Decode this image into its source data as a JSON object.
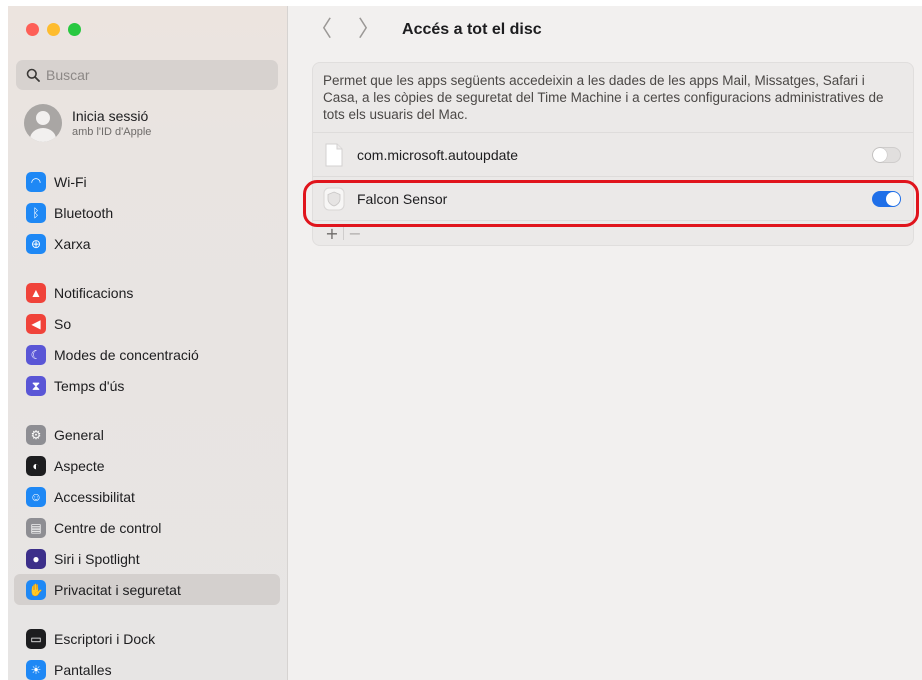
{
  "window": {
    "traffic_lights": {
      "close": "#fe5f57",
      "minimize": "#febc2e",
      "zoom": "#28c840"
    }
  },
  "sidebar": {
    "search": {
      "placeholder": "Buscar",
      "value": ""
    },
    "account": {
      "line1": "Inicia sessió",
      "line2": "amb l'ID d'Apple"
    },
    "groups": [
      [
        {
          "label": "Wi-Fi",
          "icon": "wifi-icon",
          "color": "#1e88f5",
          "glyph": "◠"
        },
        {
          "label": "Bluetooth",
          "icon": "bluetooth-icon",
          "color": "#1e88f5",
          "glyph": "ᛒ"
        },
        {
          "label": "Xarxa",
          "icon": "globe-icon",
          "color": "#1e88f5",
          "glyph": "⊕"
        }
      ],
      [
        {
          "label": "Notificacions",
          "icon": "bell-icon",
          "color": "#f0433a",
          "glyph": "▲"
        },
        {
          "label": "So",
          "icon": "speaker-icon",
          "color": "#f0433a",
          "glyph": "◀"
        },
        {
          "label": "Modes de concentració",
          "icon": "moon-icon",
          "color": "#5a56d6",
          "glyph": "☾"
        },
        {
          "label": "Temps d'ús",
          "icon": "hourglass-icon",
          "color": "#5a56d6",
          "glyph": "⧗"
        }
      ],
      [
        {
          "label": "General",
          "icon": "gear-icon",
          "color": "#8e8e93",
          "glyph": "⚙"
        },
        {
          "label": "Aspecte",
          "icon": "appearance-icon",
          "color": "#1d1d1f",
          "glyph": "◐"
        },
        {
          "label": "Accessibilitat",
          "icon": "accessibility-icon",
          "color": "#1e88f5",
          "glyph": "☺"
        },
        {
          "label": "Centre de control",
          "icon": "control-center-icon",
          "color": "#8e8e93",
          "glyph": "▤"
        },
        {
          "label": "Siri i Spotlight",
          "icon": "siri-icon",
          "color": "#3c2f8a",
          "glyph": "●"
        },
        {
          "label": "Privacitat i seguretat",
          "icon": "hand-icon",
          "color": "#1e88f5",
          "glyph": "✋",
          "selected": true
        }
      ],
      [
        {
          "label": "Escriptori i Dock",
          "icon": "dock-icon",
          "color": "#1d1d1f",
          "glyph": "▭"
        },
        {
          "label": "Pantalles",
          "icon": "sun-icon",
          "color": "#1e88f5",
          "glyph": "☀"
        }
      ]
    ]
  },
  "main": {
    "back_glyph": "〈",
    "forward_glyph": "〉",
    "title": "Accés a tot el disc",
    "description": "Permet que les apps següents accedeixin a les dades de les apps Mail, Missatges, Safari i Casa, a les còpies de seguretat del Time Machine i a certes configuracions administratives de tots els usuaris del Mac.",
    "apps": [
      {
        "name": "com.microsoft.autoupdate",
        "icon": "document-icon",
        "enabled": false
      },
      {
        "name": "Falcon Sensor",
        "icon": "shield-icon",
        "enabled": true
      }
    ],
    "add_glyph": "+",
    "remove_glyph": "−"
  },
  "colors": {
    "accent": "#1f6fe8",
    "highlight": "#e0141c"
  }
}
